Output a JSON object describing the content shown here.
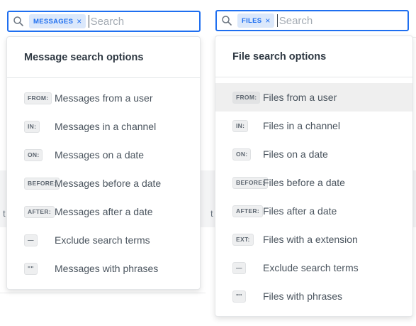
{
  "message_search": {
    "chip_label": "MESSAGES",
    "chip_remove": "×",
    "placeholder": "Search",
    "panel_title": "Message search options",
    "options": [
      {
        "badge": "FROM:",
        "label": "Messages from a user"
      },
      {
        "badge": "IN:",
        "label": "Messages in a channel"
      },
      {
        "badge": "ON:",
        "label": "Messages on a date"
      },
      {
        "badge": "BEFORE:",
        "label": "Messages before a date"
      },
      {
        "badge": "AFTER:",
        "label": "Messages after a date"
      },
      {
        "badge": "—",
        "label": "Exclude search terms"
      },
      {
        "badge": "\"\"",
        "label": "Messages with phrases"
      }
    ]
  },
  "file_search": {
    "chip_label": "FILES",
    "chip_remove": "×",
    "placeholder": "Search",
    "panel_title": "File search options",
    "highlighted_option": "FROM:",
    "options": [
      {
        "badge": "FROM:",
        "label": "Files from a user"
      },
      {
        "badge": "IN:",
        "label": "Files in a channel"
      },
      {
        "badge": "ON:",
        "label": "Files on a date"
      },
      {
        "badge": "BEFORE:",
        "label": "Files before a date"
      },
      {
        "badge": "AFTER:",
        "label": "Files after a date"
      },
      {
        "badge": "EXT:",
        "label": "Files with a extension"
      },
      {
        "badge": "—",
        "label": "Exclude search terms"
      },
      {
        "badge": "\"\"",
        "label": "Files with phrases"
      }
    ]
  },
  "background": {
    "left_glyph": "t",
    "right_glyph": "t"
  },
  "colors": {
    "accent": "#1f6ff0",
    "chip_bg": "#dbe8fb",
    "highlight_row": "#efefef"
  }
}
